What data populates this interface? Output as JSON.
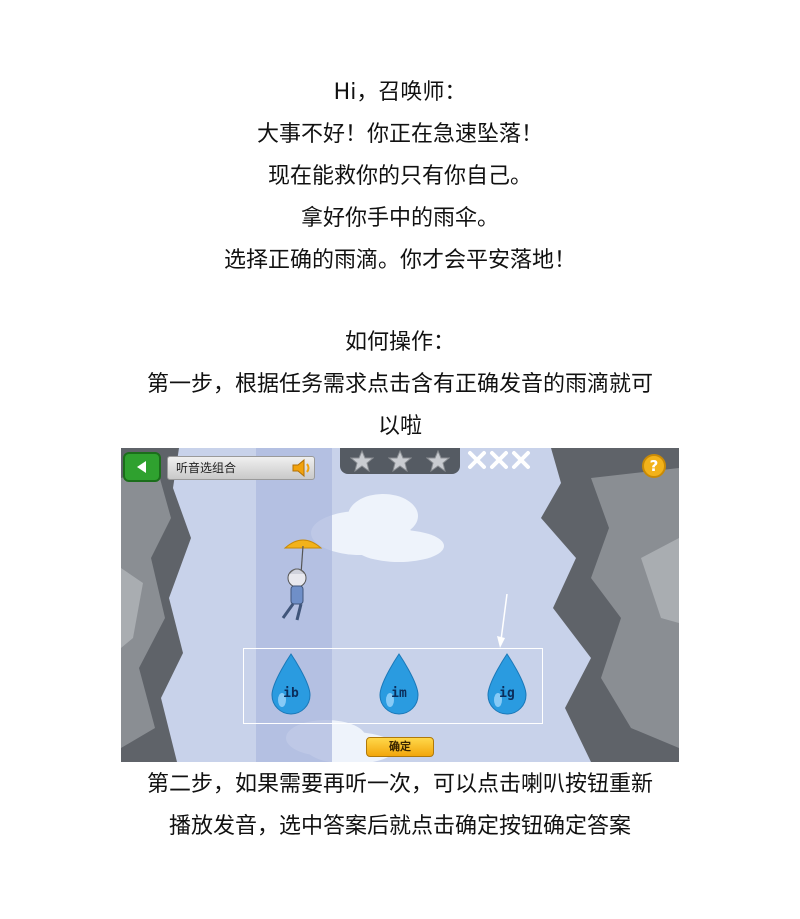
{
  "intro": {
    "lines": [
      "Hi，召唤师：",
      "大事不好！你正在急速坠落！",
      "现在能救你的只有你自己。",
      "拿好你手中的雨伞。",
      "选择正确的雨滴。你才会平安落地！"
    ]
  },
  "howto": {
    "heading": "如何操作：",
    "step1_line1": "第一步，根据任务需求点击含有正确发音的雨滴就可",
    "step1_line2": "以啦",
    "step2_line1": "第二步，如果需要再听一次，可以点击喇叭按钮重新",
    "step2_line2": "播放发音，选中答案后就点击确定按钮确定答案"
  },
  "game": {
    "title": "听音选组合",
    "stars_count": 3,
    "lives_count": 3,
    "help_label": "?",
    "options": [
      "ib",
      "im",
      "ig"
    ],
    "confirm_label": "确定",
    "colors": {
      "sky": "#c8d2ea",
      "rock": "#6b6f74",
      "drop": "#2a9be0",
      "back_button": "#2fa12f",
      "confirm_button": "#f5b51e",
      "umbrella": "#f2b21a"
    }
  }
}
